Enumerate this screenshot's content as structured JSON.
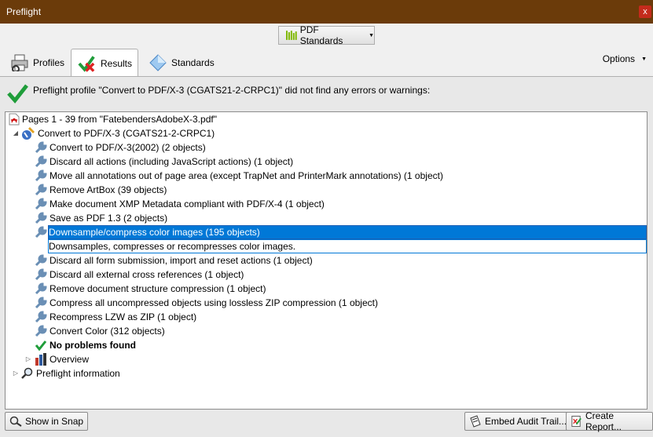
{
  "window": {
    "title": "Preflight",
    "close_label": "x"
  },
  "toolbar": {
    "standards_button": "PDF Standards"
  },
  "tabs": [
    {
      "label": "Profiles",
      "icon": "printer-icon"
    },
    {
      "label": "Results",
      "icon": "results-check-x-icon"
    },
    {
      "label": "Standards",
      "icon": "diamond-icon"
    }
  ],
  "options_label": "Options",
  "summary": {
    "message": "Preflight profile \"Convert to PDF/X-3 (CGATS21-2-CRPC1)\" did not find any errors or warnings:",
    "icon": "green-check-icon"
  },
  "tree": {
    "root": "Pages 1 - 39 from \"FatebendersAdobeX-3.pdf\"",
    "profile": "Convert to PDF/X-3 (CGATS21-2-CRPC1)",
    "fixups": [
      "Convert to PDF/X-3(2002) (2 objects)",
      "Discard all actions (including JavaScript actions) (1 object)",
      "Move all annotations out of page area (except TrapNet and PrinterMark annotations) (1 object)",
      "Remove ArtBox (39 objects)",
      "Make document XMP Metadata compliant with PDF/X-4 (1 object)",
      "Save as PDF 1.3 (2 objects)",
      "Downsample/compress color images (195 objects)",
      "Downsamples, compresses or recompresses color images.",
      "Discard all form submission, import and reset actions (1 object)",
      "Discard all external cross references (1 object)",
      "Remove document structure compression (1 object)",
      "Compress all uncompressed objects using lossless ZIP compression (1 object)",
      "Recompress LZW as ZIP (1 object)",
      "Convert Color (312 objects)"
    ],
    "no_problems": "No problems found",
    "overview": "Overview",
    "preflight_info": "Preflight information",
    "selected_index": 6
  },
  "buttons": {
    "show_in_snap": "Show in Snap",
    "embed_audit": "Embed Audit Trail...",
    "create_report": "Create Report..."
  },
  "colors": {
    "titlebar": "#6b3b0a",
    "selection": "#0078d7",
    "check_green": "#1f9d3a",
    "close_red": "#c42b1c"
  }
}
